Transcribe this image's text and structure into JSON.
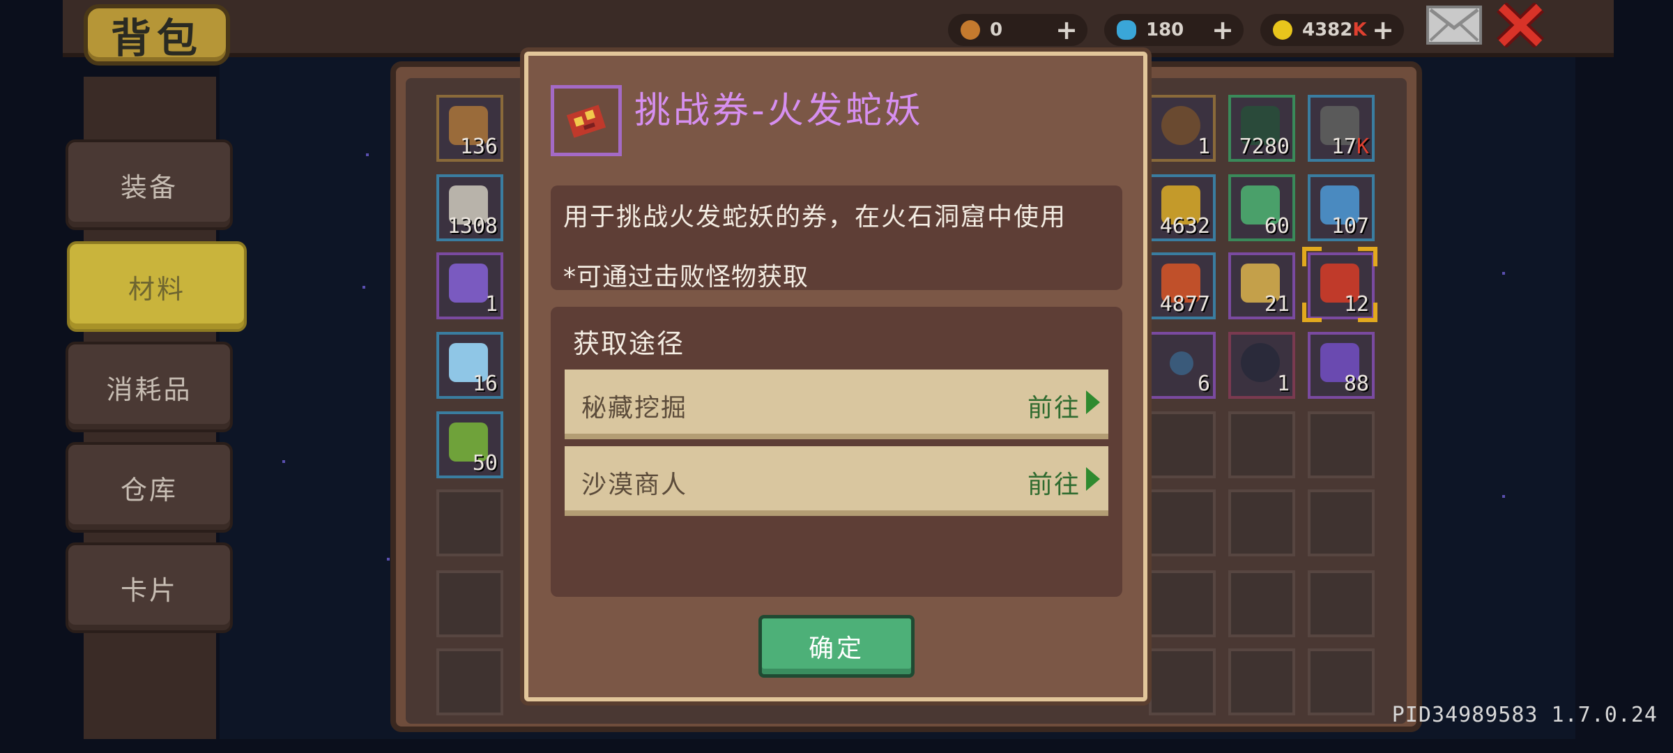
{
  "header": {
    "title": "背包",
    "currencies": [
      {
        "icon": "horn-icon",
        "value": "0",
        "plus": "+"
      },
      {
        "icon": "gem-icon",
        "value": "180",
        "plus": "+"
      },
      {
        "icon": "gold-coin-icon",
        "value": "4382",
        "suffix": "K",
        "plus": "+"
      }
    ]
  },
  "tabs": [
    {
      "label": "装备",
      "active": false
    },
    {
      "label": "材料",
      "active": true
    },
    {
      "label": "消耗品",
      "active": false
    },
    {
      "label": "仓库",
      "active": false
    },
    {
      "label": "卡片",
      "active": false
    }
  ],
  "inventory": {
    "left_col1": [
      "136",
      "1308",
      "1",
      "16",
      "50"
    ],
    "right_row1": [
      "1",
      "7280",
      "17"
    ],
    "right_row1_suffix": "K",
    "right_row2": [
      "4632",
      "60",
      "107"
    ],
    "right_row3": [
      "4877",
      "21",
      "12"
    ],
    "right_row4": [
      "6",
      "1",
      "88"
    ]
  },
  "modal": {
    "item_icon": "fire-serpent-ticket-icon",
    "title": "挑战券-火发蛇妖",
    "description": "用于挑战火发蛇妖的券，在火石洞窟中使用",
    "note": "*可通过击败怪物获取",
    "sources_title": "获取途径",
    "sources": [
      {
        "name": "秘藏挖掘",
        "action": "前往"
      },
      {
        "name": "沙漠商人",
        "action": "前往"
      }
    ],
    "confirm_label": "确定"
  },
  "footer": {
    "version": "PID34989583 1.7.0.24"
  },
  "colors": {
    "accent_gold": "#c9b43c",
    "title_purple": "#d68ff0",
    "confirm_green": "#4db078",
    "go_green": "#2f6b2f"
  }
}
